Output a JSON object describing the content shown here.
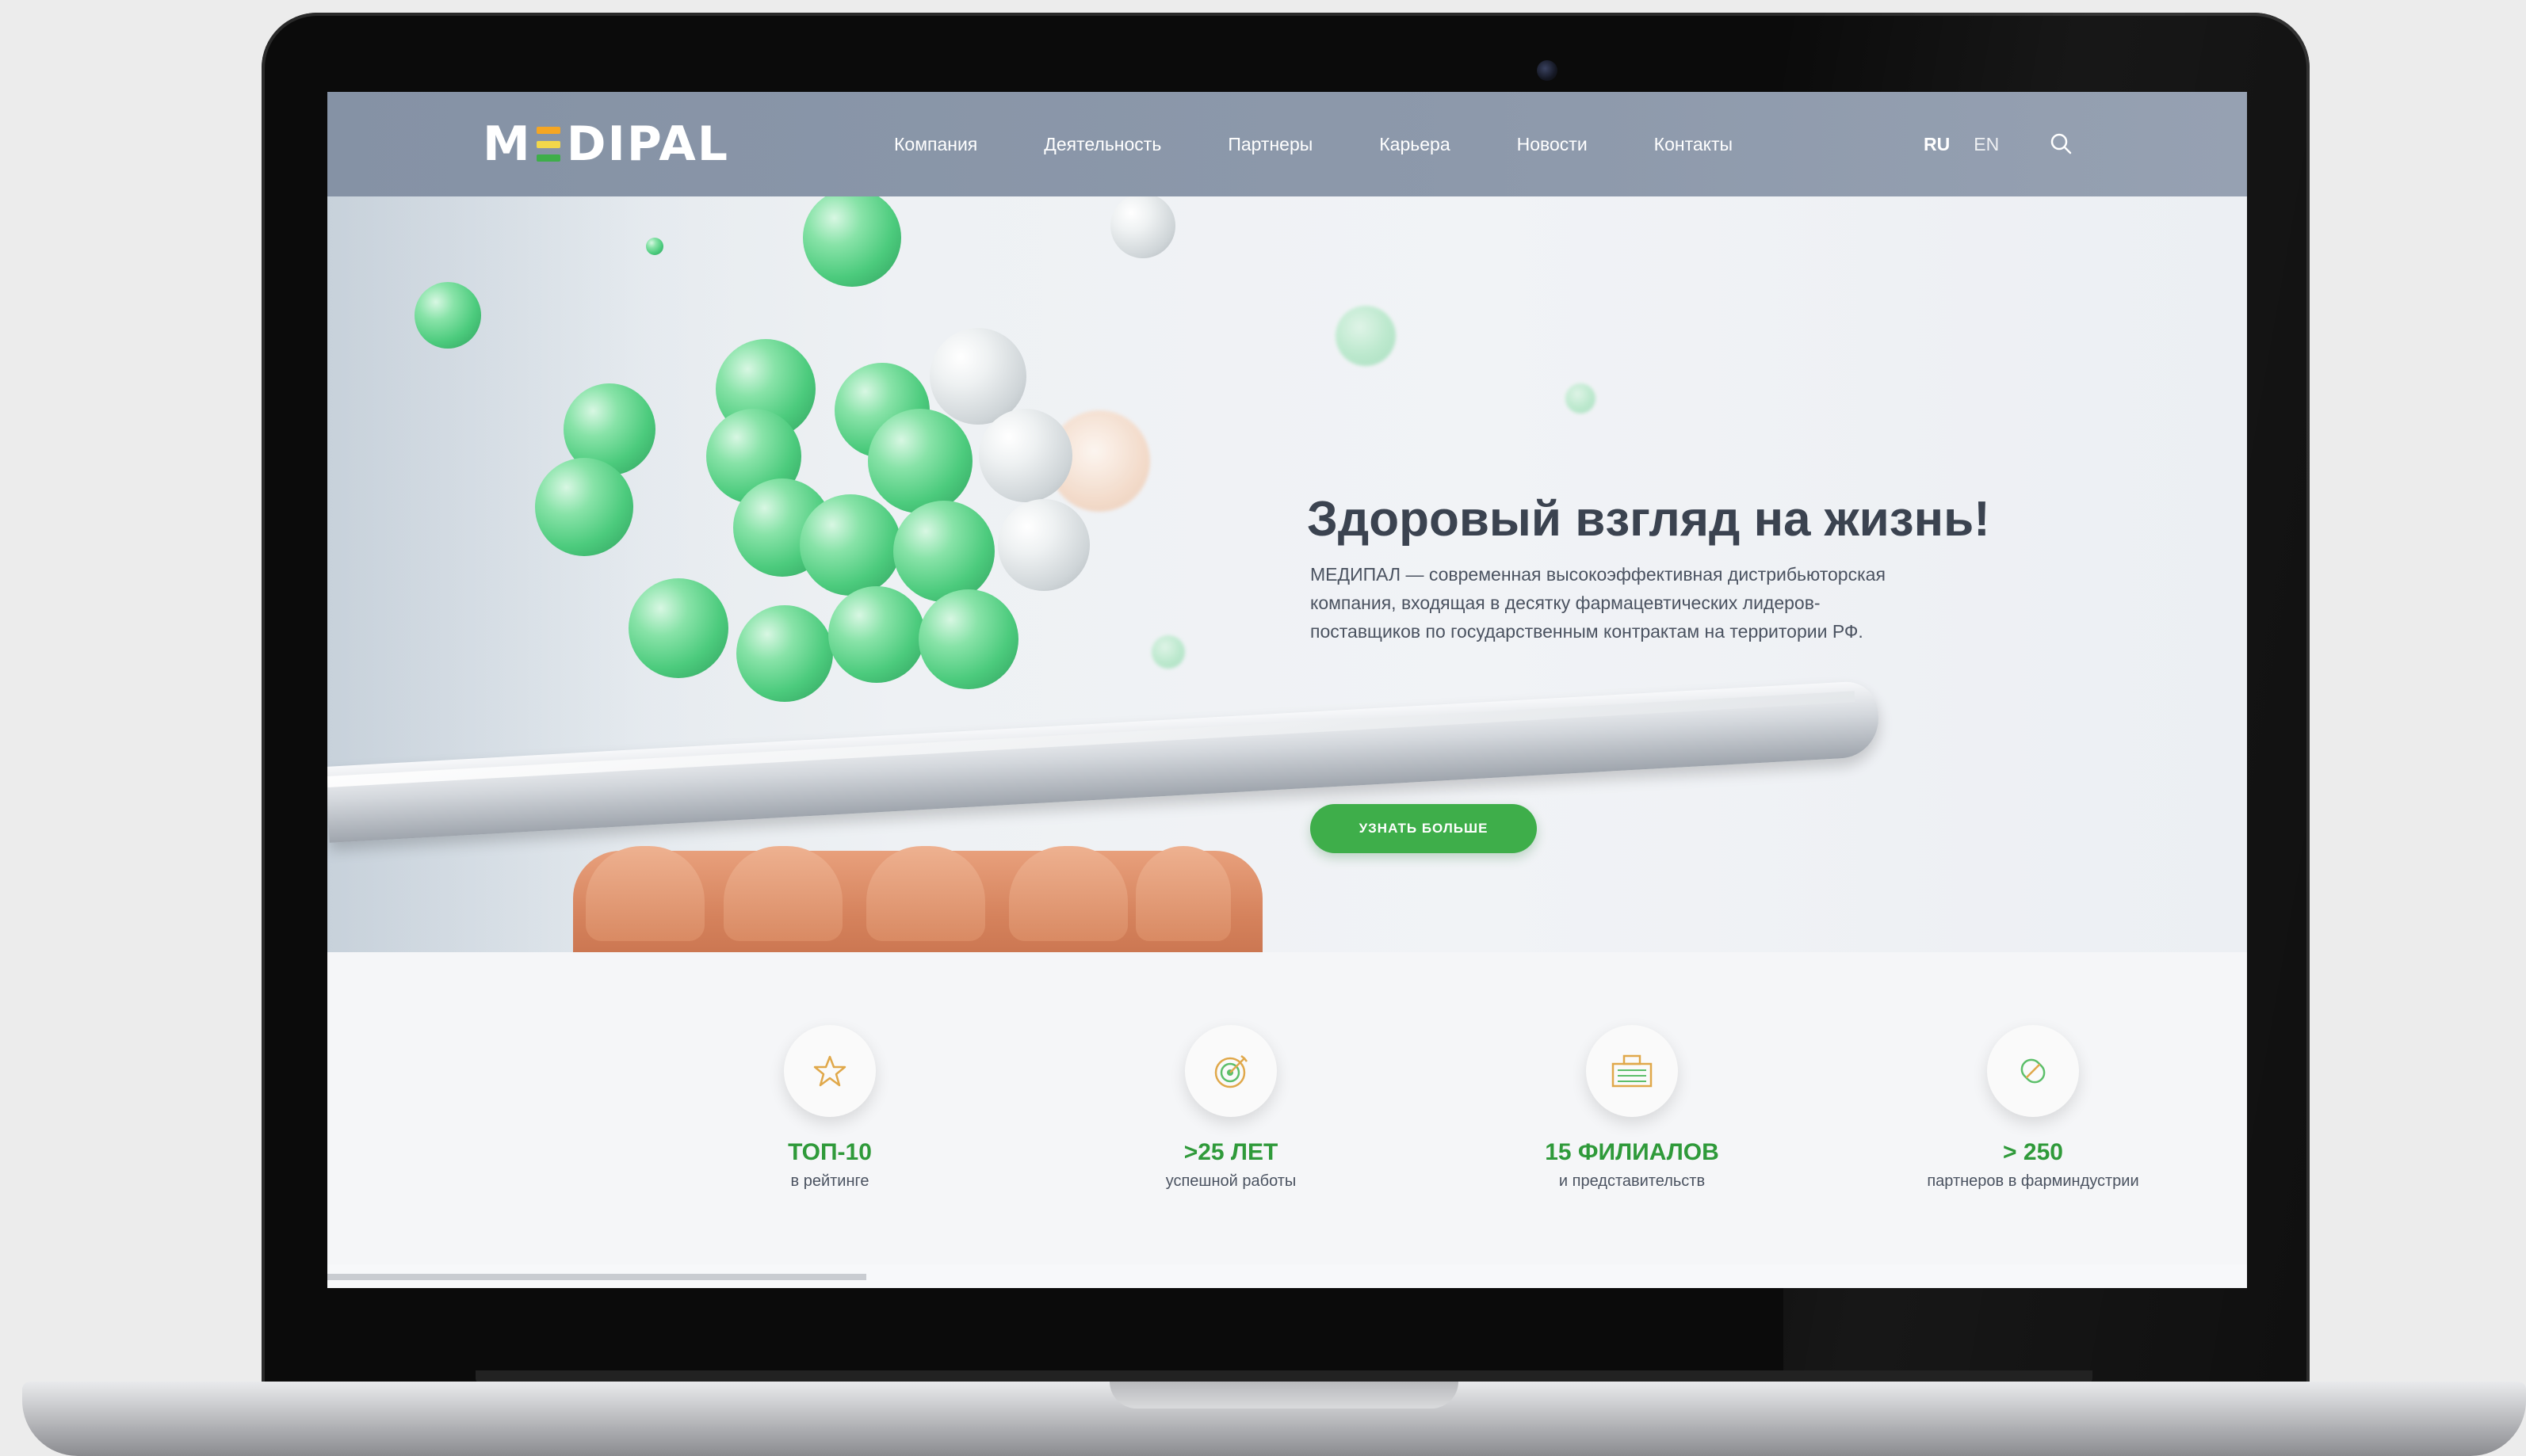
{
  "header": {
    "logo": {
      "m": "M",
      "rest": "DIPAL",
      "e_colors": [
        "#f5a623",
        "#f2d74a",
        "#3eae4a"
      ]
    },
    "nav": [
      "Компания",
      "Деятельность",
      "Партнеры",
      "Карьера",
      "Новости",
      "Контакты"
    ],
    "lang": {
      "ru": "RU",
      "en": "EN"
    },
    "search_icon": "search-icon"
  },
  "hero": {
    "title": "Здоровый взгляд на жизнь!",
    "description": "МЕДИПАЛ — современная высокоэффективная дистрибьюторская компания, входящая в десятку фармацевтических лидеров-поставщиков по государственным контрактам на территории РФ.",
    "cta": "УЗНАТЬ БОЛЬШЕ"
  },
  "stats": [
    {
      "icon": "star-icon",
      "value": "ТОП-10",
      "caption": "в рейтинге"
    },
    {
      "icon": "target-icon",
      "value": ">25 ЛЕТ",
      "caption": "успешной работы"
    },
    {
      "icon": "building-icon",
      "value": "15 ФИЛИАЛОВ",
      "caption": "и представительств"
    },
    {
      "icon": "pill-icon",
      "value": "> 250",
      "caption": "партнеров в фарминдустрии"
    }
  ],
  "colors": {
    "accent_green": "#3eae4a",
    "header_bg": "#8d99ab",
    "stat_value": "#2f9a3a"
  }
}
